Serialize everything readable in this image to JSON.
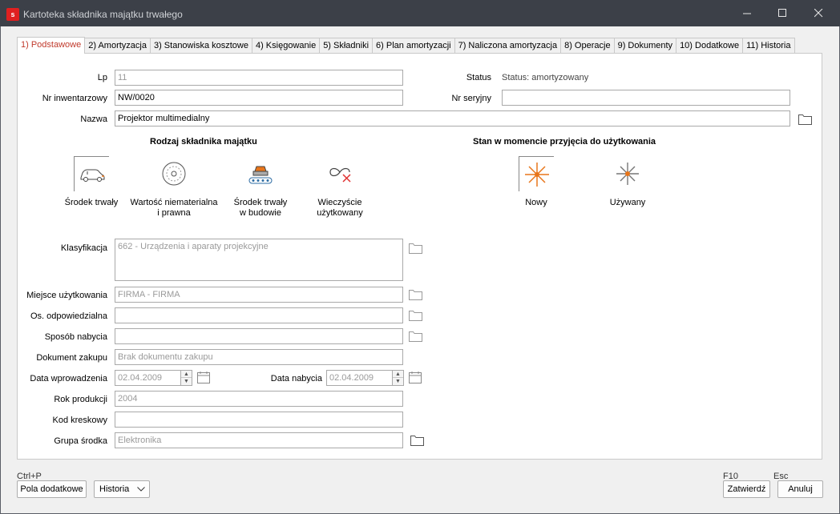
{
  "window": {
    "title": "Kartoteka składnika majątku trwałego",
    "minimize": "—",
    "maximize": "☐",
    "close": "✕"
  },
  "tabs": [
    {
      "num": "1)",
      "label": " Podstawowe",
      "active": true
    },
    {
      "num": "2)",
      "label": " Amortyzacja"
    },
    {
      "num": "3)",
      "label": " Stanowiska kosztowe"
    },
    {
      "num": "4)",
      "label": " Księgowanie"
    },
    {
      "num": "5)",
      "label": " Składniki"
    },
    {
      "num": "6)",
      "label": " Plan amortyzacji"
    },
    {
      "num": "7)",
      "label": " Naliczona amortyzacja"
    },
    {
      "num": "8)",
      "label": " Operacje"
    },
    {
      "num": "9)",
      "label": " Dokumenty"
    },
    {
      "num": "10)",
      "label": " Dodatkowe"
    },
    {
      "num": "11)",
      "label": " Historia"
    }
  ],
  "form": {
    "lp_label": "Lp",
    "lp_value": "11",
    "status_label": "Status",
    "status_value": "Status: amortyzowany",
    "inv_label": "Nr inwentarzowy",
    "inv_value": "NW/0020",
    "serial_label": "Nr seryjny",
    "serial_value": "",
    "name_label": "Nazwa",
    "name_value": "Projektor multimedialny",
    "klas_label": "Klasyfikacja",
    "klas_value": "662 - Urządzenia i aparaty projekcyjne",
    "miejsce_label": "Miejsce użytkowania",
    "miejsce_value": "FIRMA - FIRMA",
    "os_label": "Os. odpowiedzialna",
    "os_value": "",
    "sposob_label": "Sposób nabycia",
    "sposob_value": "",
    "dok_label": "Dokument zakupu",
    "dok_value": "Brak dokumentu zakupu",
    "data_wpr_label": "Data wprowadzenia",
    "data_wpr_value": "02.04.2009",
    "data_nab_label": "Data nabycia",
    "data_nab_value": "02.04.2009",
    "rok_label": "Rok produkcji",
    "rok_value": "2004",
    "kod_label": "Kod kreskowy",
    "kod_value": "",
    "grupa_label": "Grupa środka",
    "grupa_value": "Elektronika"
  },
  "asset_type": {
    "title": "Rodzaj składnika majątku",
    "options": [
      {
        "line1": "Środek trwały",
        "line2": "",
        "icon": "car-icon",
        "selected": true
      },
      {
        "line1": "Wartość niematerialna",
        "line2": "i prawna",
        "icon": "disc-icon"
      },
      {
        "line1": "Środek trwały",
        "line2": "w budowie",
        "icon": "car-on-conveyor-icon"
      },
      {
        "line1": "Wieczyście",
        "line2": "użytkowany",
        "icon": "infinity-cross-icon"
      }
    ]
  },
  "condition": {
    "title": "Stan w momencie przyjęcia do użytkowania",
    "options": [
      {
        "label": "Nowy",
        "icon": "sparkle-orange-icon",
        "selected": true
      },
      {
        "label": "Używany",
        "icon": "sparkle-grey-icon"
      }
    ]
  },
  "footer": {
    "ctrl_hint": "Ctrl+P",
    "extra_fields": "Pola dodatkowe",
    "history": "Historia",
    "f10_hint": "F10",
    "esc_hint": "Esc",
    "confirm": "Zatwierdź",
    "cancel": "Anuluj"
  },
  "colors": {
    "active_tab_text": "#c0392b",
    "icon_orange": "#e8751a",
    "titlebar": "#3c4048"
  }
}
